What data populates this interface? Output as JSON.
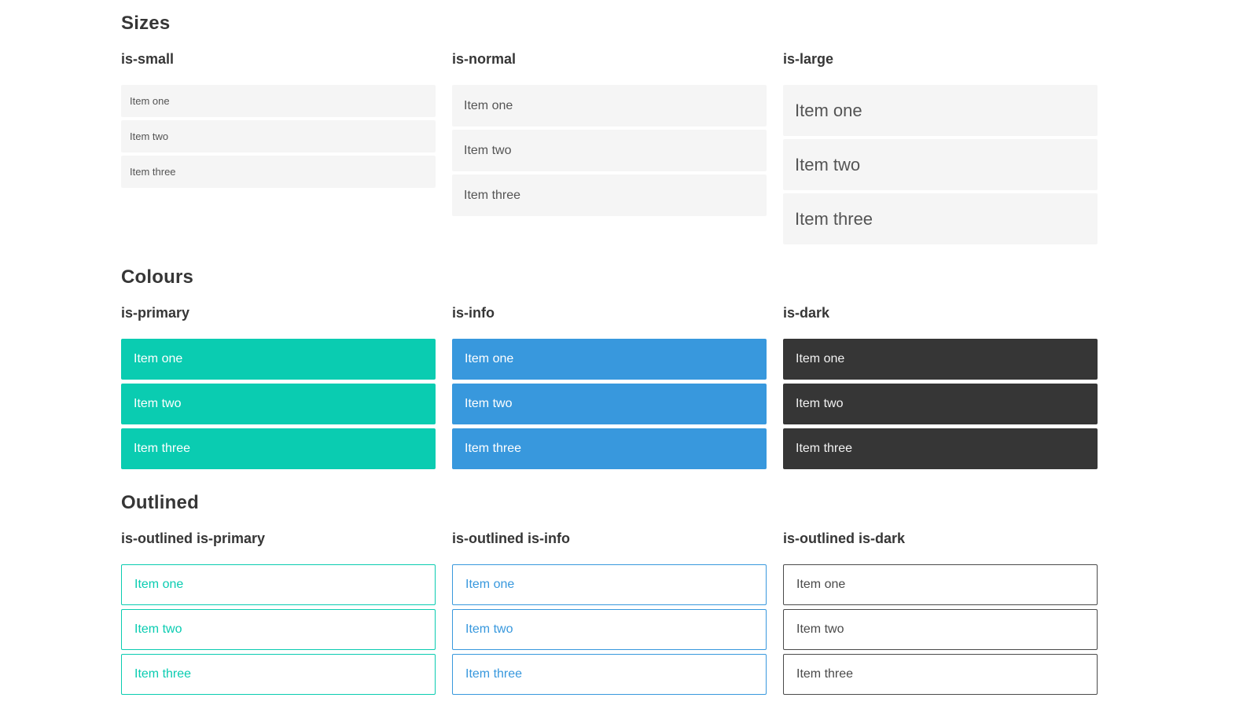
{
  "colors": {
    "primary": "#0accb1",
    "info": "#3898dd",
    "dark": "#363636",
    "light_item_bg": "#f5f5f5",
    "item_text_gray": "#545454",
    "heading_text": "#363636",
    "item_text_on_color": "#ffffff"
  },
  "sections": [
    {
      "title": "Sizes",
      "groups": [
        {
          "label": "is-small",
          "items": [
            "Item one",
            "Item two",
            "Item three"
          ]
        },
        {
          "label": "is-normal",
          "items": [
            "Item one",
            "Item two",
            "Item three"
          ]
        },
        {
          "label": "is-large",
          "items": [
            "Item one",
            "Item two",
            "Item three"
          ]
        }
      ]
    },
    {
      "title": "Colours",
      "groups": [
        {
          "label": "is-primary",
          "items": [
            "Item one",
            "Item two",
            "Item three"
          ]
        },
        {
          "label": "is-info",
          "items": [
            "Item one",
            "Item two",
            "Item three"
          ]
        },
        {
          "label": "is-dark",
          "items": [
            "Item one",
            "Item two",
            "Item three"
          ]
        }
      ]
    },
    {
      "title": "Outlined",
      "groups": [
        {
          "label": "is-outlined is-primary",
          "items": [
            "Item one",
            "Item two",
            "Item three"
          ]
        },
        {
          "label": "is-outlined is-info",
          "items": [
            "Item one",
            "Item two",
            "Item three"
          ]
        },
        {
          "label": "is-outlined is-dark",
          "items": [
            "Item one",
            "Item two",
            "Item three"
          ]
        }
      ]
    }
  ]
}
